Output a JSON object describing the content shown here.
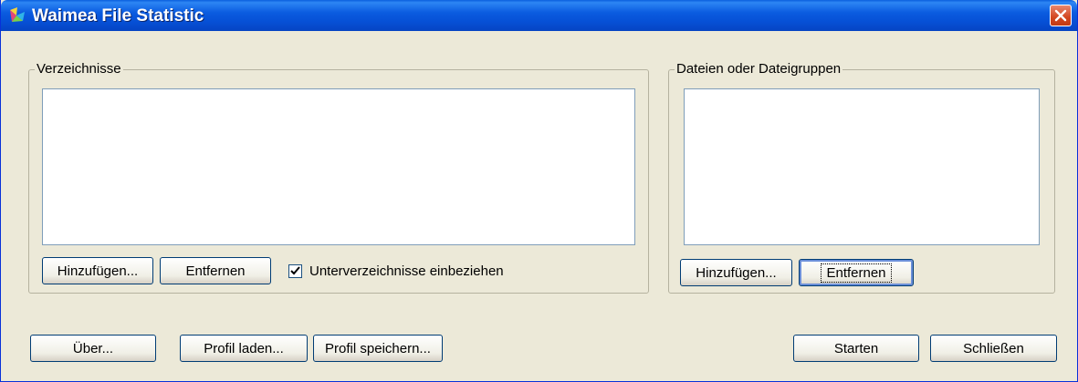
{
  "window": {
    "title": "Waimea File Statistic"
  },
  "directories": {
    "label": "Verzeichnisse",
    "items": [],
    "add_label": "Hinzufügen...",
    "remove_label": "Entfernen",
    "include_subdirs_label": "Unterverzeichnisse einbeziehen",
    "include_subdirs_checked": true
  },
  "files": {
    "label": "Dateien oder Dateigruppen",
    "items": [],
    "add_label": "Hinzufügen...",
    "remove_label": "Entfernen"
  },
  "footer": {
    "about_label": "Über...",
    "load_profile_label": "Profil laden...",
    "save_profile_label": "Profil speichern...",
    "start_label": "Starten",
    "close_label": "Schließen"
  },
  "icons": {
    "app": "app-icon",
    "close": "close-icon",
    "check": "check-icon"
  },
  "colors": {
    "title_bar": "#0650d6",
    "dialog_bg": "#ece9d8",
    "close_button": "#d3461f"
  }
}
